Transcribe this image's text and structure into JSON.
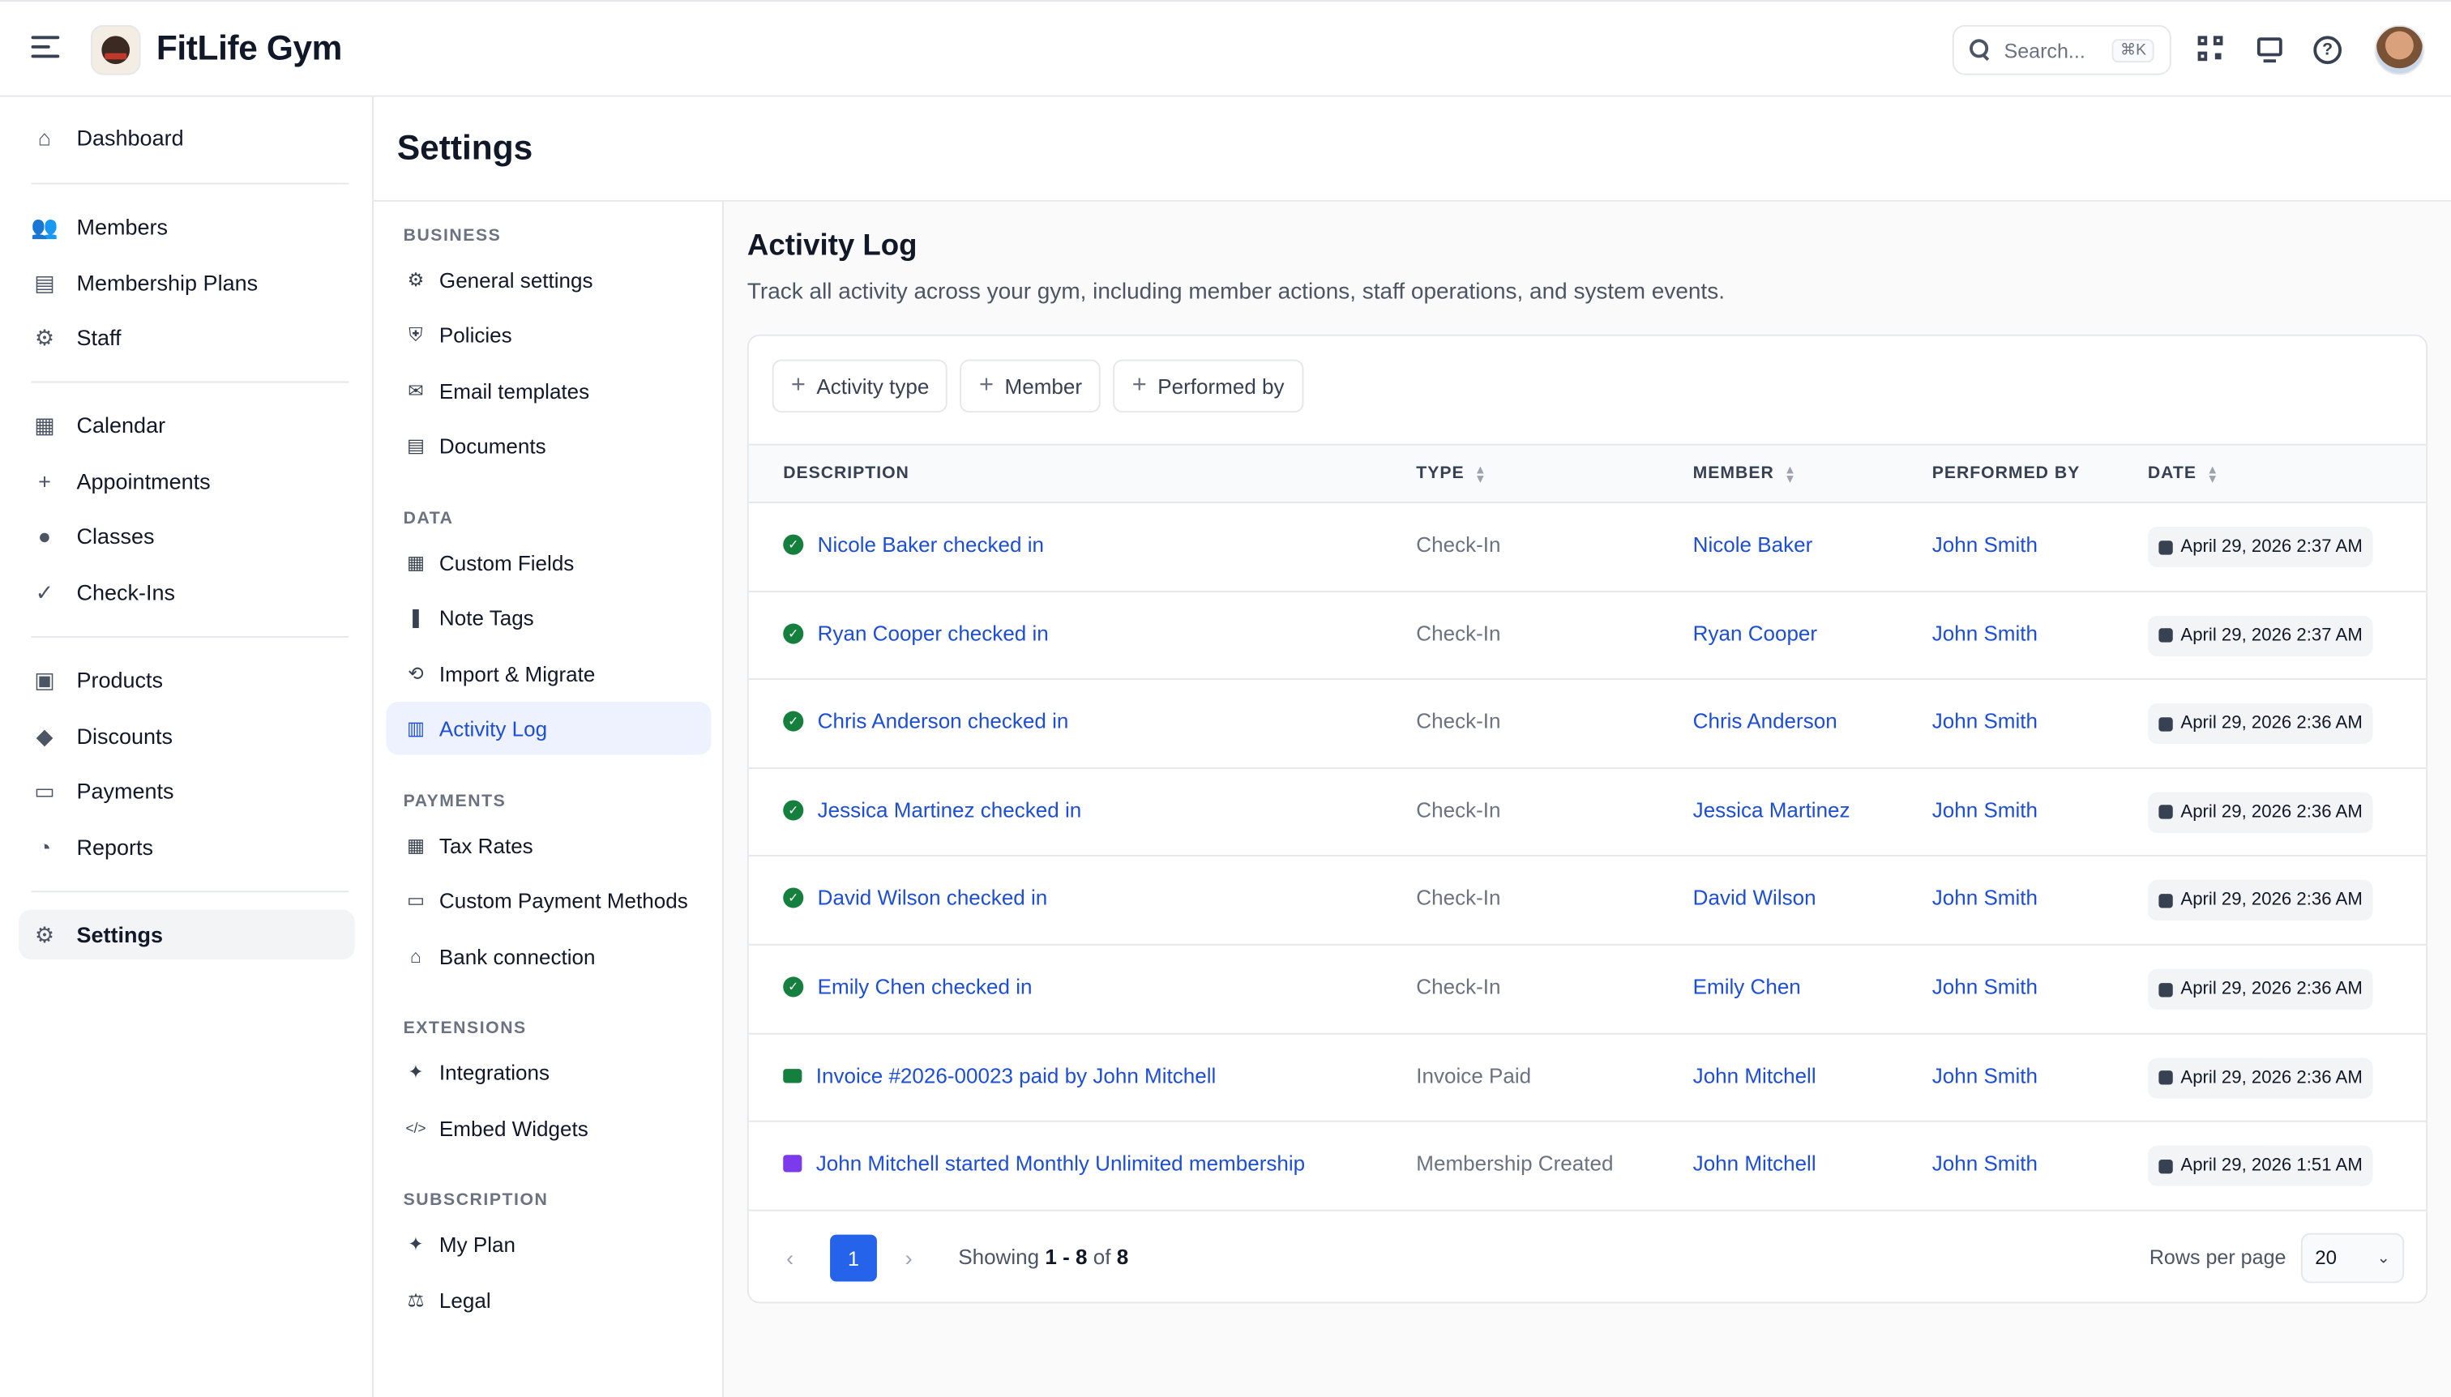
{
  "app": {
    "brand": "FitLife Gym"
  },
  "search": {
    "placeholder": "Search...",
    "shortcut": "⌘K"
  },
  "sidebar": {
    "items": [
      {
        "label": "Dashboard",
        "icon": "home-icon",
        "glyph": "⌂"
      },
      {
        "label": "Members",
        "icon": "users-icon",
        "glyph": "👥"
      },
      {
        "label": "Membership Plans",
        "icon": "id-card-icon",
        "glyph": "▤"
      },
      {
        "label": "Staff",
        "icon": "user-gear-icon",
        "glyph": "⚙"
      },
      {
        "label": "Calendar",
        "icon": "calendar-icon",
        "glyph": "▦"
      },
      {
        "label": "Appointments",
        "icon": "user-plus-icon",
        "glyph": "+"
      },
      {
        "label": "Classes",
        "icon": "group-icon",
        "glyph": "●"
      },
      {
        "label": "Check-Ins",
        "icon": "check-circle-icon",
        "glyph": "✓"
      },
      {
        "label": "Products",
        "icon": "bag-icon",
        "glyph": "▣"
      },
      {
        "label": "Discounts",
        "icon": "tag-icon",
        "glyph": "◆"
      },
      {
        "label": "Payments",
        "icon": "credit-card-icon",
        "glyph": "▭"
      },
      {
        "label": "Reports",
        "icon": "pie-chart-icon",
        "glyph": "◔"
      },
      {
        "label": "Settings",
        "icon": "gear-icon",
        "glyph": "⚙"
      }
    ]
  },
  "settings": {
    "title": "Settings"
  },
  "subnav": {
    "sections": [
      {
        "title": "BUSINESS",
        "items": [
          {
            "label": "General settings",
            "icon": "cog-icon",
            "glyph": "⚙"
          },
          {
            "label": "Policies",
            "icon": "shield-icon",
            "glyph": "⛨"
          },
          {
            "label": "Email templates",
            "icon": "envelope-icon",
            "glyph": "✉"
          },
          {
            "label": "Documents",
            "icon": "document-icon",
            "glyph": "▤"
          }
        ]
      },
      {
        "title": "DATA",
        "items": [
          {
            "label": "Custom Fields",
            "icon": "grid-icon",
            "glyph": "▦"
          },
          {
            "label": "Note Tags",
            "icon": "bookmark-icon",
            "glyph": "❚"
          },
          {
            "label": "Import & Migrate",
            "icon": "sync-icon",
            "glyph": "⟲"
          },
          {
            "label": "Activity Log",
            "icon": "clipboard-icon",
            "glyph": "▥"
          }
        ]
      },
      {
        "title": "PAYMENTS",
        "items": [
          {
            "label": "Tax Rates",
            "icon": "calculator-icon",
            "glyph": "▦"
          },
          {
            "label": "Custom Payment Methods",
            "icon": "card-icon",
            "glyph": "▭"
          },
          {
            "label": "Bank connection",
            "icon": "bank-icon",
            "glyph": "⌂"
          }
        ]
      },
      {
        "title": "EXTENSIONS",
        "items": [
          {
            "label": "Integrations",
            "icon": "puzzle-icon",
            "glyph": "✦"
          },
          {
            "label": "Embed Widgets",
            "icon": "code-icon",
            "glyph": "</>"
          }
        ]
      },
      {
        "title": "SUBSCRIPTION",
        "items": [
          {
            "label": "My Plan",
            "icon": "sparkles-icon",
            "glyph": "✦"
          },
          {
            "label": "Legal",
            "icon": "scale-icon",
            "glyph": "⚖"
          }
        ]
      }
    ]
  },
  "activity": {
    "title": "Activity Log",
    "description": "Track all activity across your gym, including member actions, staff operations, and system events.",
    "filters": [
      "Activity type",
      "Member",
      "Performed by"
    ],
    "columns": {
      "description": "DESCRIPTION",
      "type": "TYPE",
      "member": "MEMBER",
      "performed_by": "PERFORMED BY",
      "date": "DATE"
    },
    "rows": [
      {
        "description": "Nicole Baker checked in",
        "icon": "check-circle-icon",
        "type": "Check-In",
        "member": "Nicole Baker",
        "performed_by": "John Smith",
        "date": "April 29, 2026 2:37 AM"
      },
      {
        "description": "Ryan Cooper checked in",
        "icon": "check-circle-icon",
        "type": "Check-In",
        "member": "Ryan Cooper",
        "performed_by": "John Smith",
        "date": "April 29, 2026 2:37 AM"
      },
      {
        "description": "Chris Anderson checked in",
        "icon": "check-circle-icon",
        "type": "Check-In",
        "member": "Chris Anderson",
        "performed_by": "John Smith",
        "date": "April 29, 2026 2:36 AM"
      },
      {
        "description": "Jessica Martinez checked in",
        "icon": "check-circle-icon",
        "type": "Check-In",
        "member": "Jessica Martinez",
        "performed_by": "John Smith",
        "date": "April 29, 2026 2:36 AM"
      },
      {
        "description": "David Wilson checked in",
        "icon": "check-circle-icon",
        "type": "Check-In",
        "member": "David Wilson",
        "performed_by": "John Smith",
        "date": "April 29, 2026 2:36 AM"
      },
      {
        "description": "Emily Chen checked in",
        "icon": "check-circle-icon",
        "type": "Check-In",
        "member": "Emily Chen",
        "performed_by": "John Smith",
        "date": "April 29, 2026 2:36 AM"
      },
      {
        "description": "Invoice #2026-00023 paid by John Mitchell",
        "icon": "credit-card-icon",
        "type": "Invoice Paid",
        "member": "John Mitchell",
        "performed_by": "John Smith",
        "date": "April 29, 2026 2:36 AM"
      },
      {
        "description": "John Mitchell started Monthly Unlimited membership",
        "icon": "id-card-icon",
        "type": "Membership Created",
        "member": "John Mitchell",
        "performed_by": "John Smith",
        "date": "April 29, 2026 1:51 AM"
      }
    ],
    "pagination": {
      "current_page": "1",
      "showing_prefix": "Showing",
      "range": "1 - 8",
      "of_label": "of",
      "total": "8",
      "rows_per_page_label": "Rows per page",
      "rows_per_page": "20"
    }
  },
  "colors": {
    "accent": "#2563eb",
    "link": "#1d4ed8",
    "success": "#15803d"
  }
}
